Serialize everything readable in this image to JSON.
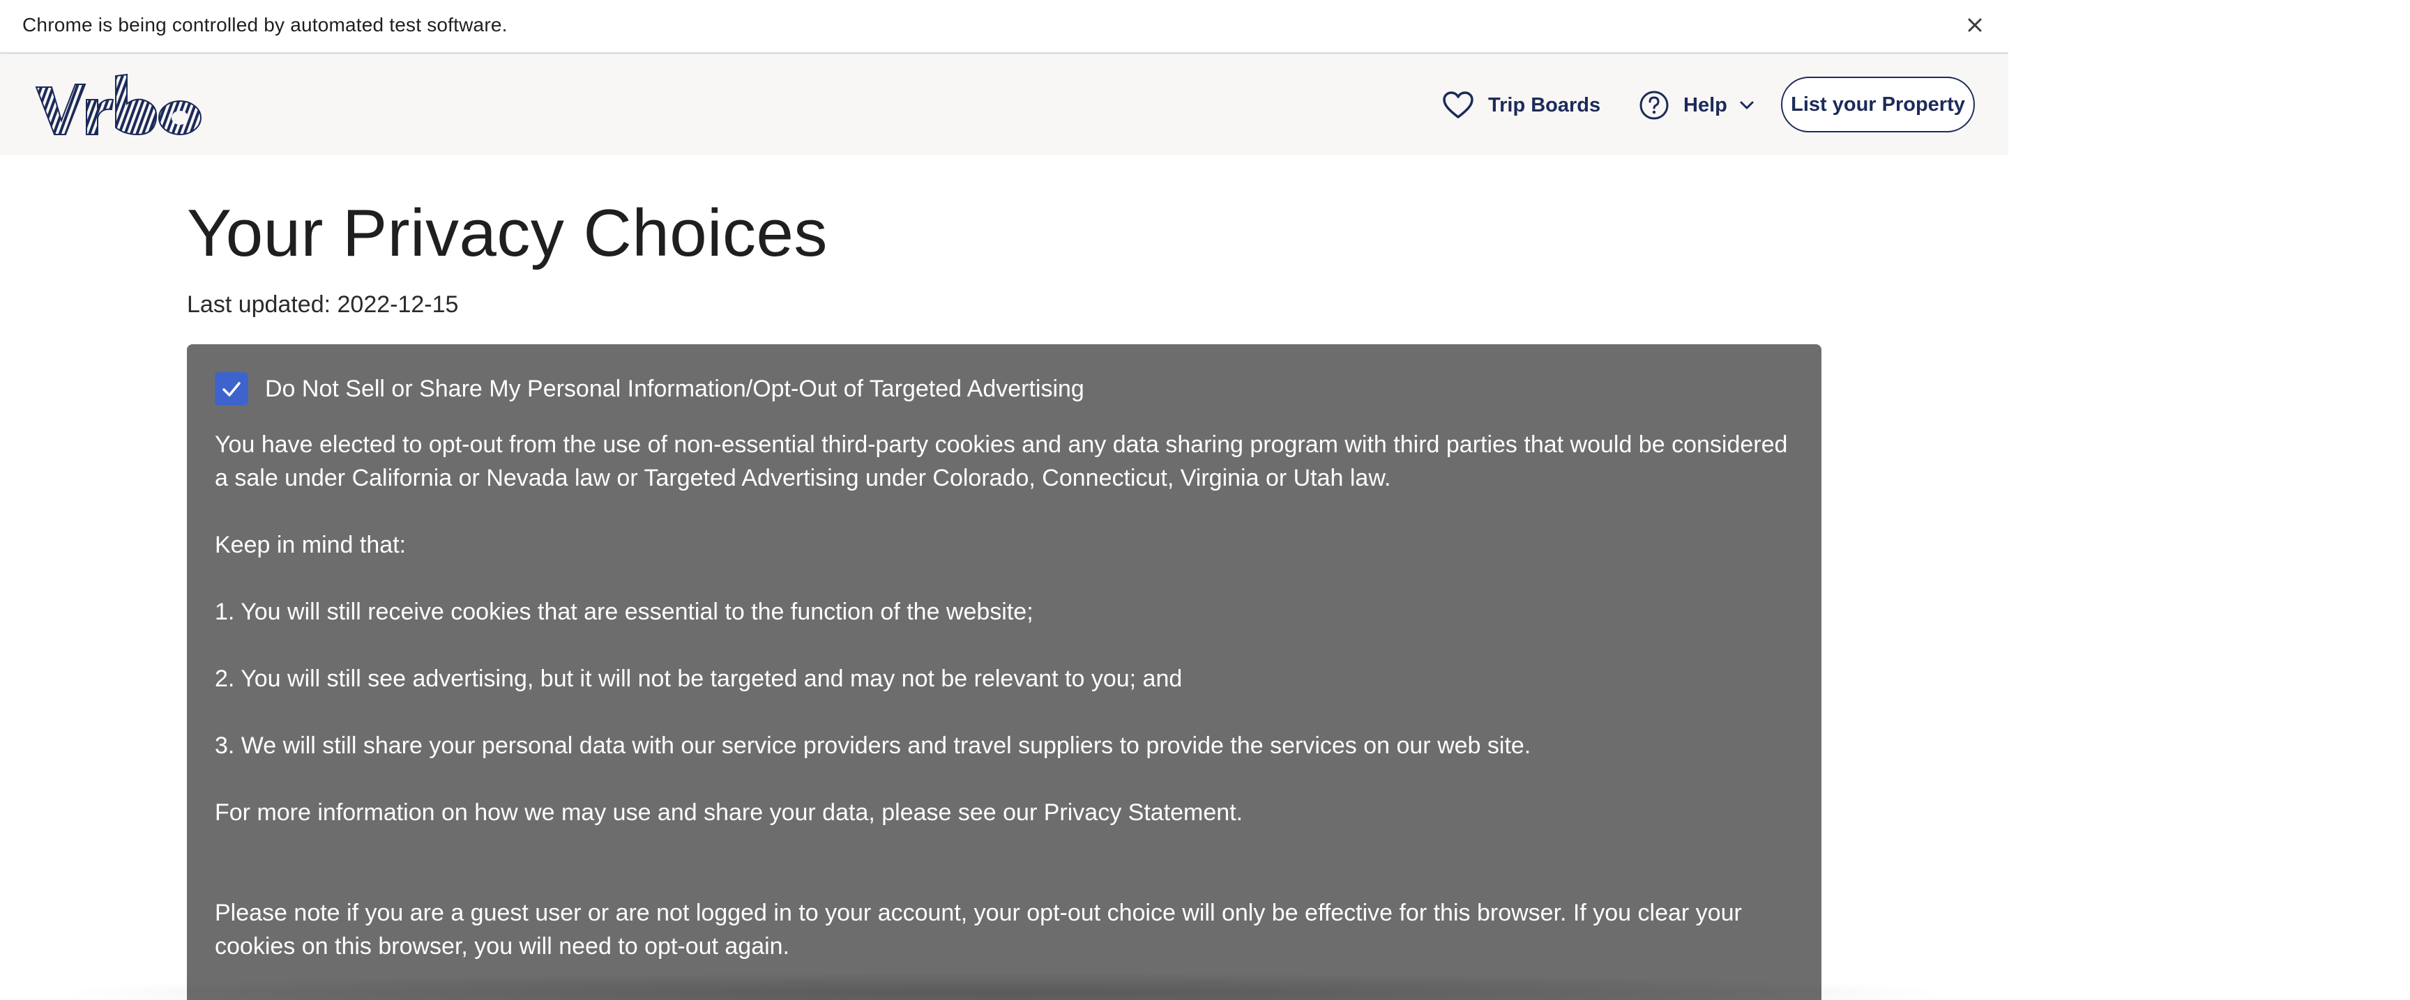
{
  "infobar": {
    "message": "Chrome is being controlled by automated test software.",
    "close_icon": "close-icon"
  },
  "header": {
    "logo_alt": "Vrbo",
    "nav": {
      "trip_boards": "Trip Boards",
      "help": "Help",
      "list_property": "List your Property"
    },
    "brand_color": "#1c2a5a"
  },
  "main": {
    "title": "Your Privacy Choices",
    "last_updated": "Last updated: 2022-12-15",
    "panel": {
      "checkbox_checked": true,
      "checkbox_label": "Do Not Sell or Share My Personal Information/Opt-Out of Targeted Advertising",
      "paragraphs": {
        "p1": "You have elected to opt-out from the use of non-essential third-party cookies and any data sharing program with third parties that would be considered a sale under California or Nevada law or Targeted Advertising under Colorado, Connecticut, Virginia or Utah law.",
        "p2": "Keep in mind that:",
        "p3": "1. You will still receive cookies that are essential to the function of the website;",
        "p4": "2. You will still see advertising, but it will not be targeted and may not be relevant to you; and",
        "p5": "3. We will still share your personal data with our service providers and travel suppliers to provide the services on our web site.",
        "p6_prefix": "For more information on how we may use and share your data, please see our ",
        "p6_link": "Privacy Statement",
        "p6_suffix": ".",
        "p7": "Please note if you are a guest user or are not logged in to your account, your opt-out choice will only be effective for this browser. If you clear your cookies on this browser, you will need to opt-out again."
      },
      "background_color": "#6d6d6d",
      "checkbox_color": "#3e63cc"
    }
  }
}
